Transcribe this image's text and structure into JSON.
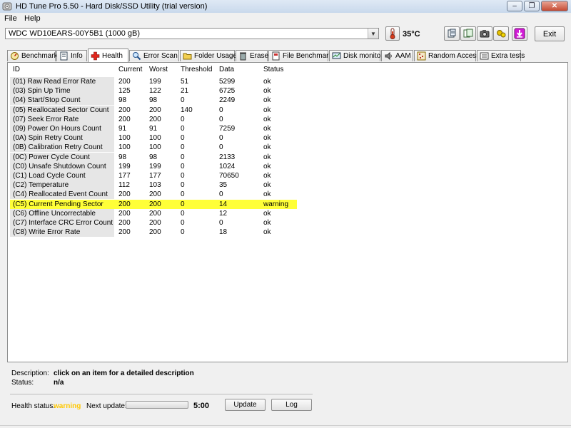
{
  "window": {
    "title": "HD Tune Pro 5.50 - Hard Disk/SSD Utility (trial version)",
    "minimize_symbol": "–",
    "maximize_symbol": "❐",
    "close_symbol": "✕"
  },
  "menu": {
    "file": "File",
    "help": "Help"
  },
  "toolbar": {
    "drive": "WDC WD10EARS-00Y5B1 (1000 gB)",
    "temperature": "35°C",
    "exit_label": "Exit",
    "icons": [
      "info-icon",
      "copy-icon",
      "screenshot-icon",
      "options-icon",
      "save-icon"
    ]
  },
  "tabs": [
    {
      "label": "Benchmark",
      "icon": "benchmark-icon"
    },
    {
      "label": "Info",
      "icon": "info-icon"
    },
    {
      "label": "Health",
      "icon": "health-icon",
      "active": true
    },
    {
      "label": "Error Scan",
      "icon": "error-scan-icon"
    },
    {
      "label": "Folder Usage",
      "icon": "folder-icon"
    },
    {
      "label": "Erase",
      "icon": "erase-icon"
    },
    {
      "label": "File Benchmark",
      "icon": "file-benchmark-icon"
    },
    {
      "label": "Disk monitor",
      "icon": "disk-monitor-icon"
    },
    {
      "label": "AAM",
      "icon": "aam-icon"
    },
    {
      "label": "Random Access",
      "icon": "random-access-icon"
    },
    {
      "label": "Extra tests",
      "icon": "extra-tests-icon"
    }
  ],
  "table": {
    "columns": [
      "ID",
      "Current",
      "Worst",
      "Threshold",
      "Data",
      "Status"
    ],
    "rows": [
      [
        "(01) Raw Read Error Rate",
        "200",
        "199",
        "51",
        "5299",
        "ok"
      ],
      [
        "(03) Spin Up Time",
        "125",
        "122",
        "21",
        "6725",
        "ok"
      ],
      [
        "(04) Start/Stop Count",
        "98",
        "98",
        "0",
        "2249",
        "ok"
      ],
      [
        "(05) Reallocated Sector Count",
        "200",
        "200",
        "140",
        "0",
        "ok"
      ],
      [
        "(07) Seek Error Rate",
        "200",
        "200",
        "0",
        "0",
        "ok"
      ],
      [
        "(09) Power On Hours Count",
        "91",
        "91",
        "0",
        "7259",
        "ok"
      ],
      [
        "(0A) Spin Retry Count",
        "100",
        "100",
        "0",
        "0",
        "ok"
      ],
      [
        "(0B) Calibration Retry Count",
        "100",
        "100",
        "0",
        "0",
        "ok"
      ],
      [
        "(0C) Power Cycle Count",
        "98",
        "98",
        "0",
        "2133",
        "ok"
      ],
      [
        "(C0) Unsafe Shutdown Count",
        "199",
        "199",
        "0",
        "1024",
        "ok"
      ],
      [
        "(C1) Load Cycle Count",
        "177",
        "177",
        "0",
        "70650",
        "ok"
      ],
      [
        "(C2) Temperature",
        "112",
        "103",
        "0",
        "35",
        "ok"
      ],
      [
        "(C4) Reallocated Event Count",
        "200",
        "200",
        "0",
        "0",
        "ok"
      ],
      [
        "(C5) Current Pending Sector",
        "200",
        "200",
        "0",
        "14",
        "warning"
      ],
      [
        "(C6) Offline Uncorrectable",
        "200",
        "200",
        "0",
        "12",
        "ok"
      ],
      [
        "(C7) Interface CRC Error Count",
        "200",
        "200",
        "0",
        "0",
        "ok"
      ],
      [
        "(C8) Write Error Rate",
        "200",
        "200",
        "0",
        "18",
        "ok"
      ]
    ],
    "warning_row_color": "#ffff38"
  },
  "details": {
    "description_label": "Description:",
    "description_value": "click on an item for a detailed description",
    "status_label": "Status:",
    "status_value": "n/a"
  },
  "health": {
    "label": "Health status:",
    "value": "warning",
    "value_color": "#ffc800",
    "next_update_label": "Next update:",
    "next_update_time": "5:00",
    "progress_fraction": 0.0,
    "update_label": "Update",
    "log_label": "Log"
  }
}
